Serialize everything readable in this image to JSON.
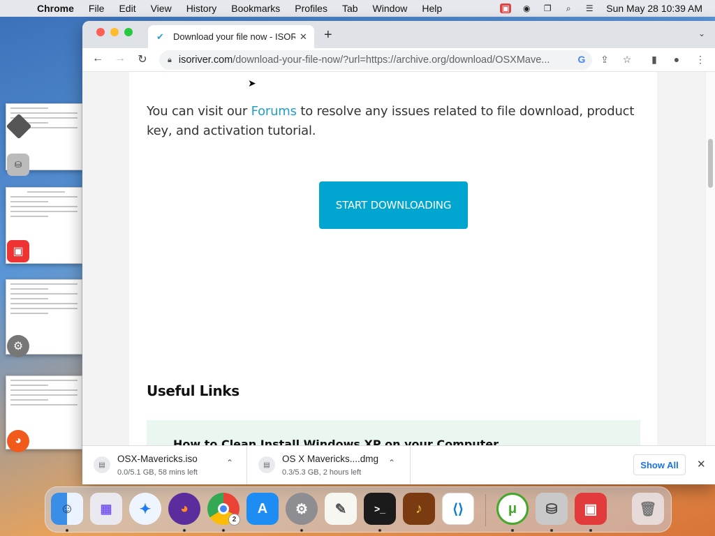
{
  "menubar": {
    "app_name": "Chrome",
    "items": [
      "File",
      "Edit",
      "View",
      "History",
      "Bookmarks",
      "Profiles",
      "Tab",
      "Window",
      "Help"
    ],
    "clock": "Sun May 28  10:39 AM"
  },
  "browser": {
    "tab_title": "Download your file now - ISORIVER",
    "url_host": "isoriver.com",
    "url_path": "/download-your-file-now/?url=https://archive.org/download/OSXMave..."
  },
  "page": {
    "para_before": "You can visit our ",
    "forums_link": "Forums",
    "para_after": " to resolve any issues related to file download, product key, and activation tutorial.",
    "download_button": "START DOWNLOADING",
    "useful_links_heading": "Useful Links",
    "first_link": "How to Clean Install Windows XP on your Computer"
  },
  "downloads": [
    {
      "name": "OSX-Mavericks.iso",
      "status": "0.0/5.1 GB, 58 mins left"
    },
    {
      "name": "OS X Mavericks....dmg",
      "status": "0.3/5.3 GB, 2 hours left"
    }
  ],
  "downloads_bar": {
    "show_all": "Show All"
  },
  "dock": {
    "chrome_badge": "2"
  },
  "colors": {
    "accent": "#00a6cf",
    "link": "#1f9ec9",
    "show_all": "#1a73e8"
  }
}
